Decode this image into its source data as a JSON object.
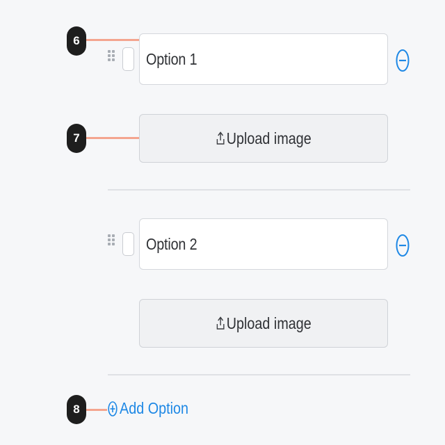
{
  "markers": {
    "first": "6",
    "second": "7",
    "third": "8"
  },
  "options": [
    {
      "value": "Option 1",
      "upload_label": "Upload image"
    },
    {
      "value": "Option 2",
      "upload_label": "Upload image"
    }
  ],
  "add_option_label": "Add Option",
  "colors": {
    "accent": "#1e88e5",
    "leader": "#f4a58f",
    "marker_bg": "#1e1e1e",
    "background": "#f6f7f9"
  },
  "icons": {
    "drag": "drag-handle-icon",
    "remove": "minus-circle-icon",
    "upload": "upload-icon",
    "add": "plus-circle-icon"
  }
}
